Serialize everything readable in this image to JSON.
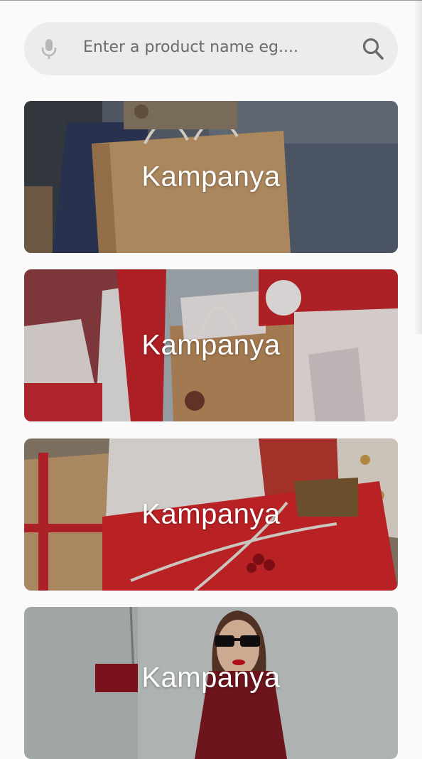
{
  "search": {
    "placeholder": "Enter a product name eg....",
    "mic_icon": "microphone-icon",
    "search_icon": "search-icon"
  },
  "campaigns": [
    {
      "label": "Kampanya",
      "scene": "shopping-bags-street"
    },
    {
      "label": "Kampanya",
      "scene": "red-white-gift-bags"
    },
    {
      "label": "Kampanya",
      "scene": "wrapped-gift-boxes"
    },
    {
      "label": "Kampanya",
      "scene": "woman-with-sunglasses"
    }
  ],
  "colors": {
    "background": "#fafafa",
    "search_bg": "#ececec",
    "icon_gray": "#6e6e6e",
    "text_white": "#ffffff"
  }
}
